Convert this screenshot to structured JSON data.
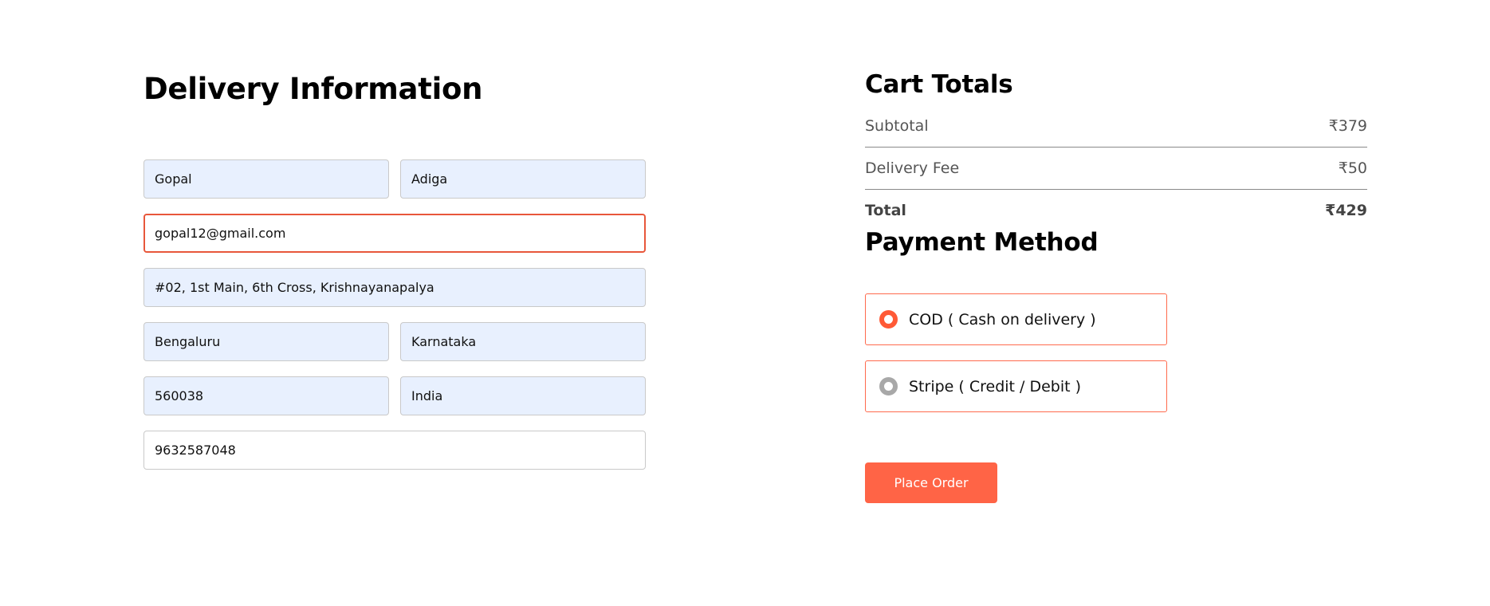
{
  "delivery": {
    "title": "Delivery Information",
    "fields": {
      "first_name": "Gopal",
      "last_name": "Adiga",
      "email": "gopal12@gmail.com",
      "street": "#02, 1st Main, 6th Cross, Krishnayanapalya",
      "city": "Bengaluru",
      "state": "Karnataka",
      "zip": "560038",
      "country": "India",
      "phone": "9632587048"
    }
  },
  "cart": {
    "title": "Cart Totals",
    "subtotal_label": "Subtotal",
    "subtotal_value": "₹379",
    "delivery_fee_label": "Delivery Fee",
    "delivery_fee_value": "₹50",
    "total_label": "Total",
    "total_value": "₹429"
  },
  "payment": {
    "title": "Payment Method",
    "options": [
      {
        "label": "COD ( Cash on delivery )",
        "selected": true
      },
      {
        "label": "Stripe ( Credit / Debit )",
        "selected": false
      }
    ],
    "place_order_label": "Place Order"
  },
  "colors": {
    "accent": "#ff6446",
    "focus_border": "#e8573b",
    "autofill_bg": "#e8f0fe"
  }
}
